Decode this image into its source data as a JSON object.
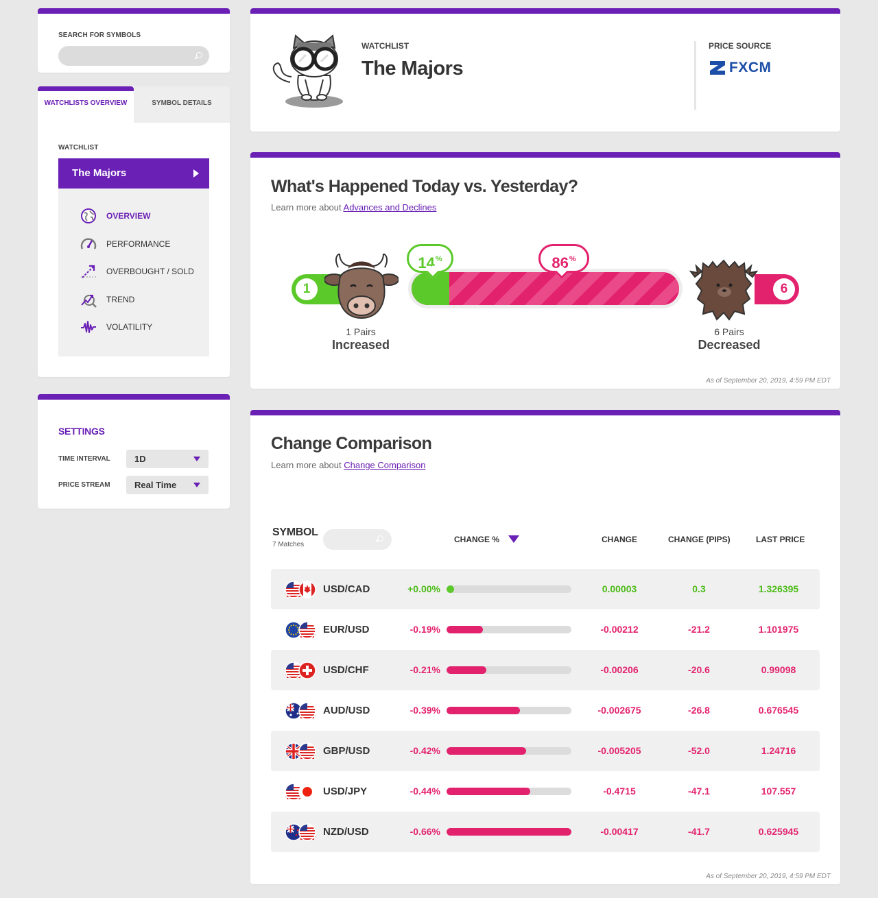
{
  "search": {
    "label": "SEARCH FOR SYMBOLS",
    "placeholder": ""
  },
  "tabs": [
    {
      "label": "WATCHLISTS OVERVIEW"
    },
    {
      "label": "SYMBOL DETAILS"
    }
  ],
  "sidebar": {
    "watchlist_label": "WATCHLIST",
    "watchlist_value": "The Majors",
    "items": [
      {
        "label": "OVERVIEW",
        "icon": "globe-icon",
        "active": true
      },
      {
        "label": "PERFORMANCE",
        "icon": "gauge-icon",
        "active": false
      },
      {
        "label": "OVERBOUGHT / SOLD",
        "icon": "trend-arrow-icon",
        "active": false
      },
      {
        "label": "TREND",
        "icon": "magnifier-trend-icon",
        "active": false
      },
      {
        "label": "VOLATILITY",
        "icon": "pulse-icon",
        "active": false
      }
    ]
  },
  "settings": {
    "title": "SETTINGS",
    "time_interval_label": "TIME INTERVAL",
    "time_interval_value": "1D",
    "price_stream_label": "PRICE STREAM",
    "price_stream_value": "Real Time"
  },
  "header": {
    "watchlist_label": "WATCHLIST",
    "title": "The Majors",
    "price_source_label": "PRICE SOURCE",
    "price_source_brand": "FXCM"
  },
  "advances": {
    "title": "What's Happened Today vs. Yesterday?",
    "learn_prefix": "Learn more about ",
    "learn_link": "Advances and Declines",
    "increased_count": "1",
    "decreased_count": "6",
    "increased_pct": "14",
    "decreased_pct": "86",
    "pct_sign": "%",
    "increased_sub": "1 Pairs",
    "increased_label": "Increased",
    "decreased_sub": "6 Pairs",
    "decreased_label": "Decreased",
    "as_of": "As of September 20, 2019, 4:59 PM EDT"
  },
  "change": {
    "title": "Change Comparison",
    "learn_prefix": "Learn more about ",
    "learn_link": "Change Comparison",
    "symbol_header": "SYMBOL",
    "matches": "7 Matches",
    "col_change_pct": "CHANGE %",
    "col_change": "CHANGE",
    "col_pips": "CHANGE (PIPS)",
    "col_last": "LAST PRICE",
    "as_of": "As of September 20, 2019, 4:59 PM EDT",
    "rows": [
      {
        "pair": "USD/CAD",
        "flags": [
          "us",
          "ca"
        ],
        "pct": "+0.00%",
        "fill": 0.0,
        "change": "0.00003",
        "pips": "0.3",
        "last": "1.326395",
        "dir": "pos"
      },
      {
        "pair": "EUR/USD",
        "flags": [
          "eu",
          "us"
        ],
        "pct": "-0.19%",
        "fill": 0.29,
        "change": "-0.00212",
        "pips": "-21.2",
        "last": "1.101975",
        "dir": "neg"
      },
      {
        "pair": "USD/CHF",
        "flags": [
          "us",
          "ch"
        ],
        "pct": "-0.21%",
        "fill": 0.32,
        "change": "-0.00206",
        "pips": "-20.6",
        "last": "0.99098",
        "dir": "neg"
      },
      {
        "pair": "AUD/USD",
        "flags": [
          "au",
          "us"
        ],
        "pct": "-0.39%",
        "fill": 0.59,
        "change": "-0.002675",
        "pips": "-26.8",
        "last": "0.676545",
        "dir": "neg"
      },
      {
        "pair": "GBP/USD",
        "flags": [
          "gb",
          "us"
        ],
        "pct": "-0.42%",
        "fill": 0.64,
        "change": "-0.005205",
        "pips": "-52.0",
        "last": "1.24716",
        "dir": "neg"
      },
      {
        "pair": "USD/JPY",
        "flags": [
          "us",
          "jp"
        ],
        "pct": "-0.44%",
        "fill": 0.67,
        "change": "-0.4715",
        "pips": "-47.1",
        "last": "107.557",
        "dir": "neg"
      },
      {
        "pair": "NZD/USD",
        "flags": [
          "nz",
          "us"
        ],
        "pct": "-0.66%",
        "fill": 1.0,
        "change": "-0.00417",
        "pips": "-41.7",
        "last": "0.625945",
        "dir": "neg"
      }
    ]
  },
  "colors": {
    "brand": "#6a1fb5",
    "positive": "#5cc92a",
    "negative": "#e3226e",
    "fxcm": "#1d4fa8"
  }
}
